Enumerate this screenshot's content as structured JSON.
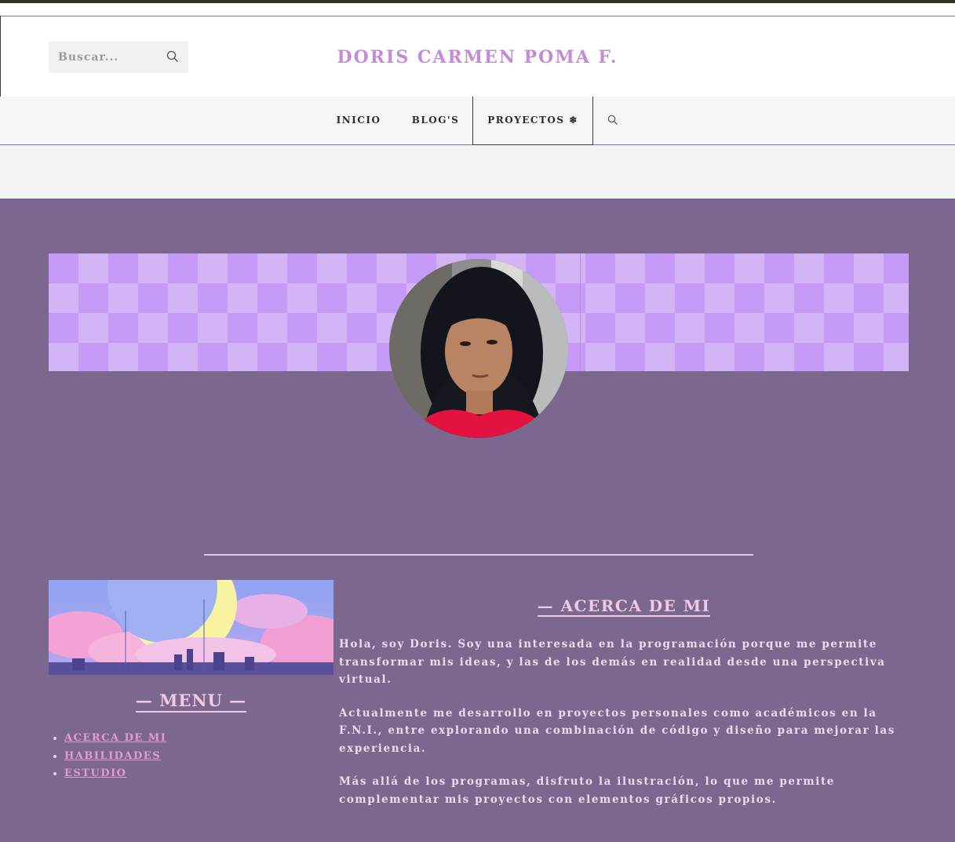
{
  "header": {
    "site_title": "DORIS CARMEN POMA F.",
    "search": {
      "placeholder": "Buscar..."
    }
  },
  "nav": {
    "items": [
      {
        "label": "INICIO"
      },
      {
        "label": "BLOG'S"
      },
      {
        "label": "PROYECTOS ❄"
      }
    ],
    "active_item": "PROYECTOS ❄"
  },
  "profile": {
    "banner_colors": {
      "light": "#d3b4f5",
      "dark": "#c69af7"
    }
  },
  "sidebar": {
    "menu_title": "— MENU —",
    "links": [
      {
        "label": "ACERCA DE MI"
      },
      {
        "label": "HABILIDADES"
      },
      {
        "label": "ESTUDIO"
      }
    ]
  },
  "about": {
    "title": "— ACERCA DE MI",
    "paragraphs": [
      "Hola, soy Doris. Soy una interesada en la programación porque me permite transformar mis ideas, y las de los demás en realidad desde una perspectiva virtual.",
      "Actualmente me desarrollo en proyectos personales como académicos en la F.N.I., entre explorando una combinación de código y diseño para mejorar las experiencia.",
      "Más allá de los programas, disfruto la ilustración, lo que me permite complementar mis proyectos con elementos gráficos propios."
    ]
  },
  "colors": {
    "main_background": "#7c688e",
    "title_pink": "#c58bd5",
    "link_pink": "#e39ad7",
    "heading_pink": "#f0c9e8",
    "nav_border": "#8c6d99"
  }
}
